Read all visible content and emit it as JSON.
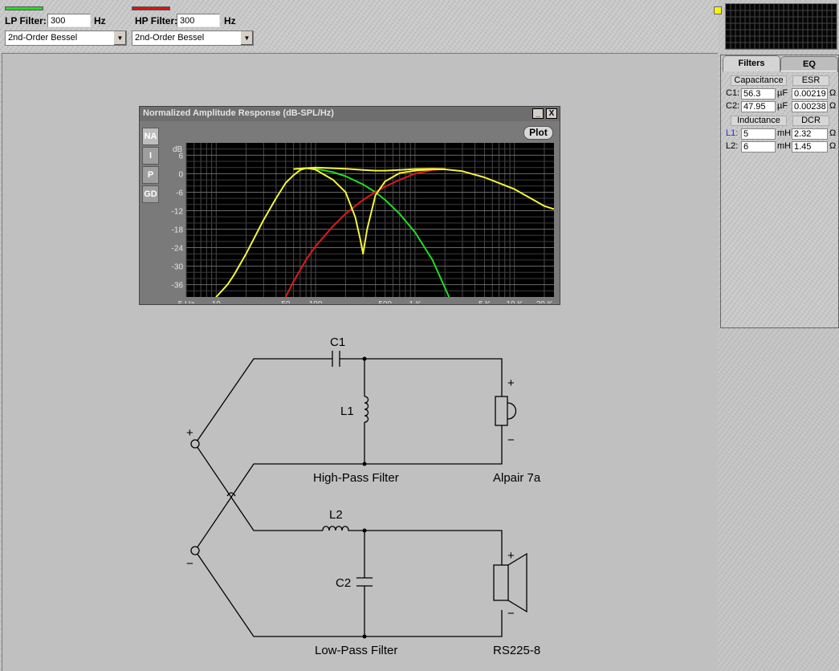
{
  "lp_filter": {
    "label": "LP Filter:",
    "value": "300",
    "unit": "Hz",
    "type": "2nd-Order Bessel",
    "color": "#20e020"
  },
  "hp_filter": {
    "label": "HP Filter:",
    "value": "300",
    "unit": "Hz",
    "type": "2nd-Order Bessel",
    "color": "#e01010"
  },
  "panel": {
    "tabs": [
      "Filters",
      "EQ"
    ],
    "capacitance_header": "Capacitance",
    "esr_header": "ESR",
    "inductance_header": "Inductance",
    "dcr_header": "DCR",
    "capacitors": [
      {
        "label": "C1:",
        "value": "56.3",
        "unit": "µF",
        "esr": "0.00219",
        "esr_unit": "Ω"
      },
      {
        "label": "C2:",
        "value": "47.95",
        "unit": "µF",
        "esr": "0.00238",
        "esr_unit": "Ω"
      }
    ],
    "inductors": [
      {
        "label": "L1:",
        "value": "5",
        "unit": "mH",
        "dcr": "2.32",
        "dcr_unit": "Ω"
      },
      {
        "label": "L2:",
        "value": "6",
        "unit": "mH",
        "dcr": "1.45",
        "dcr_unit": "Ω"
      }
    ]
  },
  "chart_window": {
    "title": "Normalized Amplitude Response (dB-SPL/Hz)",
    "side_tabs": [
      "NA",
      "I",
      "P",
      "GD"
    ],
    "active_tab": "NA",
    "plot_button": "Plot",
    "minimize_glyph": "_",
    "close_glyph": "X"
  },
  "chart_data": {
    "type": "line",
    "x_scale": "log",
    "xlim": [
      5,
      25000
    ],
    "ylim": [
      -40,
      10
    ],
    "ylabel": "dB",
    "y_ticks": [
      6,
      0,
      -6,
      -12,
      -18,
      -24,
      -30,
      -36
    ],
    "x_ticks": [
      {
        "value": 5,
        "label": "5 Hz"
      },
      {
        "value": 10,
        "label": "10"
      },
      {
        "value": 50,
        "label": "50"
      },
      {
        "value": 100,
        "label": "100"
      },
      {
        "value": 500,
        "label": "500"
      },
      {
        "value": 1000,
        "label": "1 K"
      },
      {
        "value": 5000,
        "label": "5 K"
      },
      {
        "value": 10000,
        "label": "10 K"
      },
      {
        "value": 20000,
        "label": "20 K"
      }
    ],
    "grid": true,
    "series": [
      {
        "color": "#22dd22",
        "x": [
          60,
          80,
          100,
          150,
          200,
          300,
          400,
          500,
          700,
          1000,
          1500,
          2200
        ],
        "y": [
          1.5,
          1.8,
          1.6,
          0.5,
          -0.8,
          -3.5,
          -6,
          -8.5,
          -13,
          -19,
          -28,
          -40
        ]
      },
      {
        "color": "#dd1a1a",
        "x": [
          50,
          60,
          80,
          100,
          150,
          200,
          300,
          400,
          500,
          700,
          1000,
          1500,
          2000
        ],
        "y": [
          -40,
          -35,
          -28,
          -23.5,
          -17,
          -13,
          -8.5,
          -6,
          -4.2,
          -2,
          0,
          1.2,
          1.5
        ]
      },
      {
        "color": "#f4f43a",
        "x": [
          5,
          10,
          13,
          15,
          20,
          30,
          40,
          50,
          60,
          70,
          80,
          90,
          100,
          150,
          200,
          250,
          280,
          300,
          330,
          400,
          500,
          700,
          1000,
          1500,
          2000,
          3000,
          5000,
          10000,
          20000,
          25000
        ],
        "y": [
          -55,
          -40,
          -36,
          -33,
          -26,
          -15,
          -8,
          -3,
          -0.5,
          1.2,
          1.8,
          1.6,
          1.3,
          -2,
          -6,
          -14,
          -21,
          -26,
          -18,
          -7,
          -2.5,
          0.2,
          1,
          1.4,
          1.4,
          0.8,
          -1.2,
          -5,
          -10.5,
          -11.5
        ]
      },
      {
        "color": "#f4f43a",
        "x": [
          60,
          80,
          100,
          200,
          300,
          400,
          500,
          700,
          1000,
          1500,
          2000
        ],
        "y": [
          1.5,
          1.8,
          2,
          1.6,
          1.2,
          1.0,
          1.0,
          1.2,
          1.5,
          1.6,
          1.5
        ]
      }
    ]
  },
  "schematic": {
    "c1": "C1",
    "l1": "L1",
    "l2": "L2",
    "c2": "C2",
    "hp_label": "High-Pass Filter",
    "lp_label": "Low-Pass Filter",
    "tweeter": "Alpair 7a",
    "woofer": "RS225-8",
    "plus": "+",
    "minus": "−",
    "spk_plus": "+",
    "spk_minus": "−"
  }
}
